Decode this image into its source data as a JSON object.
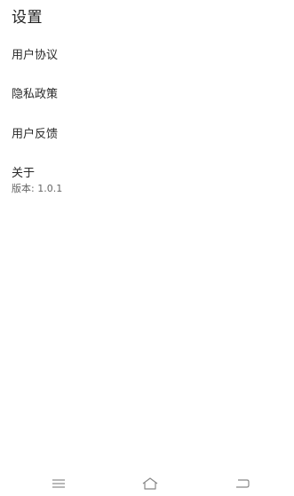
{
  "header": {
    "title": "设置"
  },
  "menu": {
    "user_agreement": "用户协议",
    "privacy_policy": "隐私政策",
    "user_feedback": "用户反馈",
    "about_label": "关于",
    "version_text": "版本: 1.0.1"
  },
  "navbar": {
    "icons": [
      "menu-icon",
      "home-icon",
      "back-icon"
    ],
    "icon_color": "#888888"
  }
}
